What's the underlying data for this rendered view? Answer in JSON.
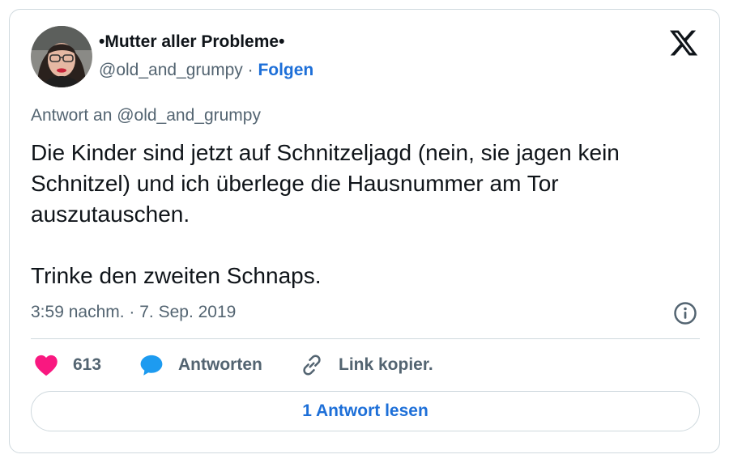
{
  "author": {
    "display_name": "•Mutter aller Probleme•",
    "handle": "@old_and_grumpy",
    "separator": " · ",
    "follow_label": "Folgen"
  },
  "tweet": {
    "reply_context": "Antwort an @old_and_grumpy",
    "paragraph_1": "Die Kinder sind jetzt auf Schnitzeljagd (nein, sie jagen kein Schnitzel) und ich überlege die Hausnummer am Tor auszutauschen.",
    "paragraph_2": "Trinke den zweiten Schnaps.",
    "timestamp": "3:59 nachm. · 7. Sep. 2019"
  },
  "actions": {
    "like_count": "613",
    "reply_label": "Antworten",
    "copy_link_label": "Link kopier."
  },
  "read_replies_label": "1 Antwort lesen",
  "icons": {
    "logo": "x-logo-icon",
    "info": "info-icon",
    "like": "heart-icon",
    "reply": "speech-bubble-icon",
    "copy": "link-icon"
  },
  "colors": {
    "like": "#f91880",
    "reply": "#1d9bf0",
    "link_blue": "#1d6fd8",
    "secondary_text": "#536471"
  }
}
